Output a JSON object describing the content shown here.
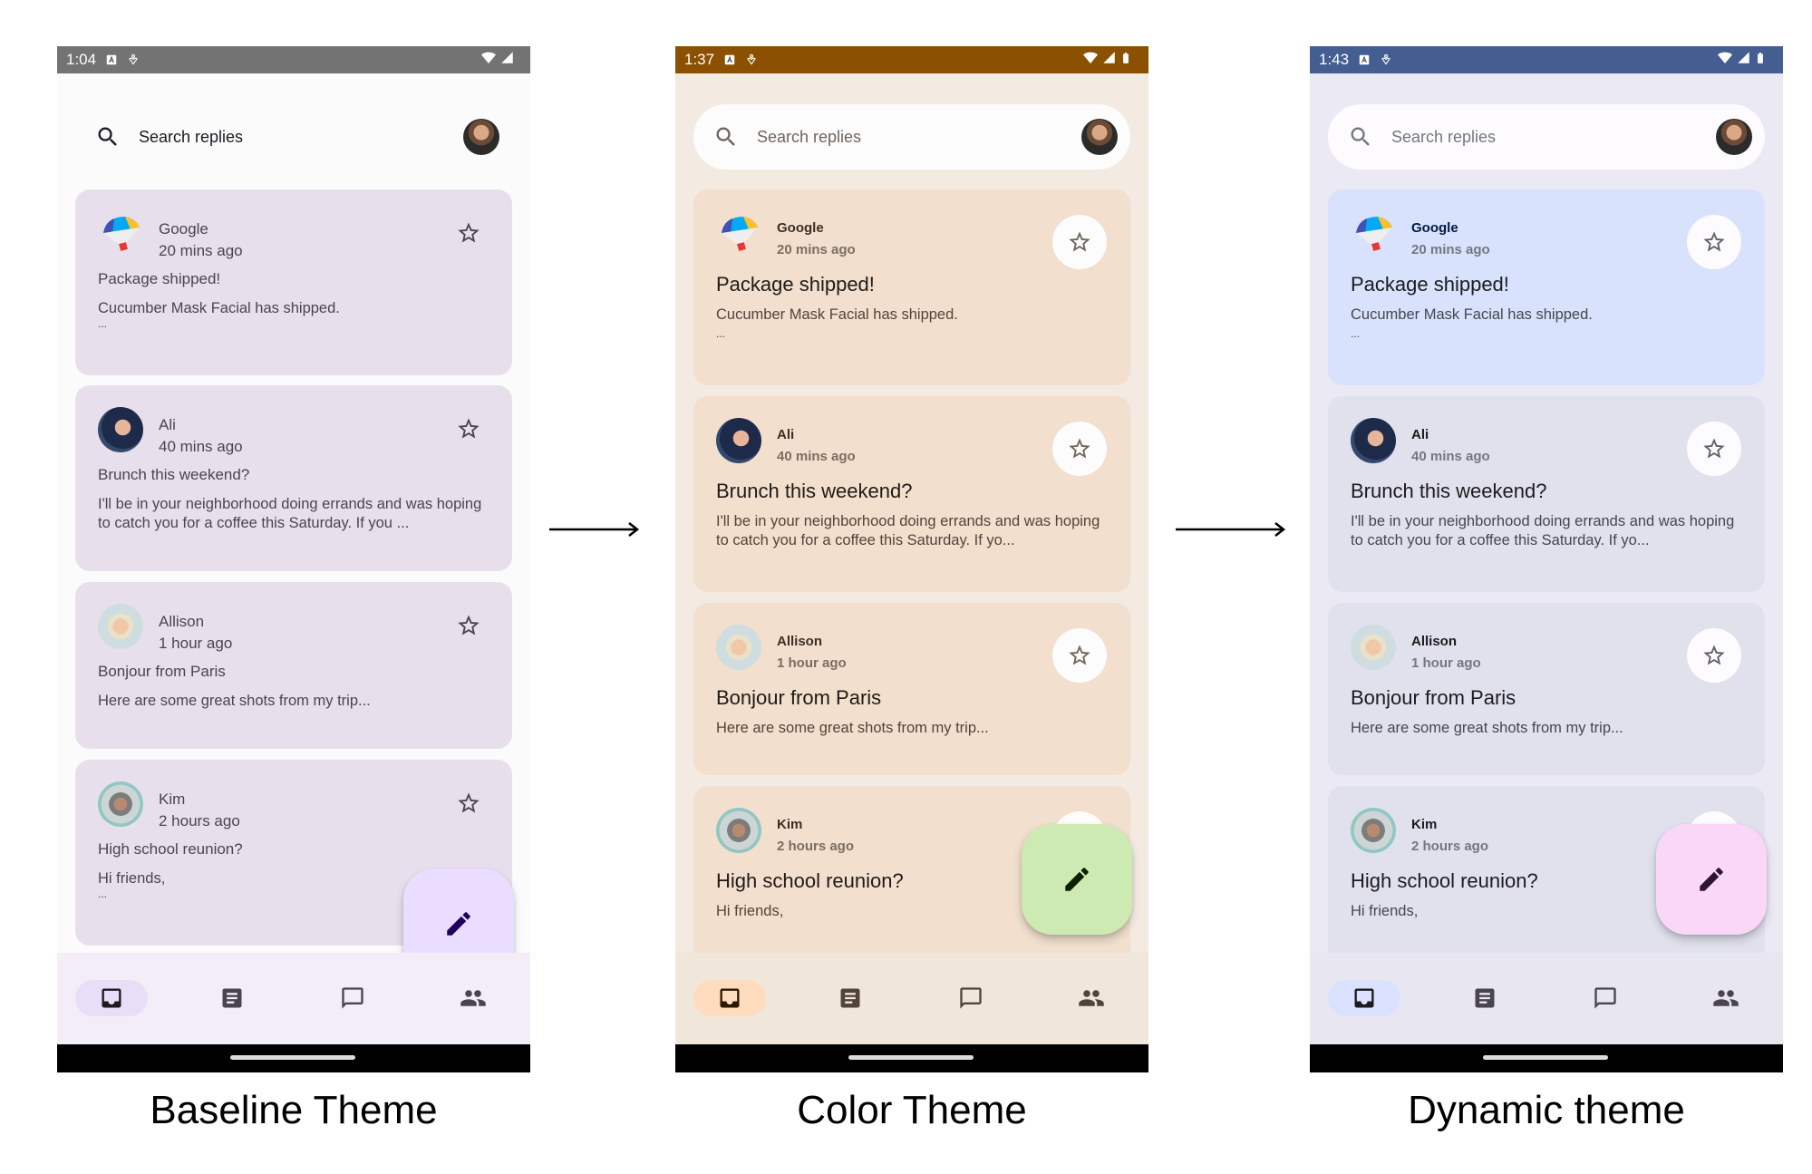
{
  "captions": [
    "Baseline Theme",
    "Color Theme",
    "Dynamic theme"
  ],
  "phones": [
    {
      "theme": "baseline",
      "status_time": "1:04",
      "status_icons": [
        "a-icon",
        "accessibility-icon",
        "wifi-icon",
        "signal-icon"
      ],
      "search_placeholder": "Search replies",
      "emails": [
        {
          "sender": "Google",
          "time": "20 mins ago",
          "subject": "Package shipped!",
          "body": "Cucumber Mask Facial has shipped.",
          "ellipsis": "..."
        },
        {
          "sender": "Ali",
          "time": "40 mins ago",
          "subject": "Brunch this weekend?",
          "body": "I'll be in your neighborhood doing errands and was hoping to catch you for a coffee this Saturday. If you ..."
        },
        {
          "sender": "Allison",
          "time": "1 hour ago",
          "subject": "Bonjour from Paris",
          "body": "Here are some great shots from my trip..."
        },
        {
          "sender": "Kim",
          "time": "2 hours ago",
          "subject": "High school reunion?",
          "body": "Hi friends,",
          "ellipsis": "..."
        }
      ],
      "nav": [
        "inbox",
        "articles",
        "direct-messages",
        "groups"
      ],
      "active_nav": "inbox",
      "colors": {
        "status_bar": "#737373",
        "card": "#e7e0ec",
        "fab": "#eaddff",
        "fab_icon": "#21005d"
      }
    },
    {
      "theme": "color",
      "status_time": "1:37",
      "status_icons": [
        "a-icon",
        "accessibility-icon",
        "wifi-icon",
        "signal-icon",
        "battery-icon"
      ],
      "search_placeholder": "Search replies",
      "emails": [
        {
          "sender": "Google",
          "time": "20 mins ago",
          "subject": "Package shipped!",
          "body": "Cucumber Mask Facial has shipped.",
          "ellipsis": "..."
        },
        {
          "sender": "Ali",
          "time": "40 mins ago",
          "subject": "Brunch this weekend?",
          "body": "I'll be in your neighborhood doing errands and was hoping to catch you for a coffee this Saturday. If yo..."
        },
        {
          "sender": "Allison",
          "time": "1 hour ago",
          "subject": "Bonjour from Paris",
          "body": "Here are some great shots from my trip..."
        },
        {
          "sender": "Kim",
          "time": "2 hours ago",
          "subject": "High school reunion?",
          "body": "Hi friends,"
        }
      ],
      "nav": [
        "inbox",
        "articles",
        "direct-messages",
        "groups"
      ],
      "active_nav": "inbox",
      "colors": {
        "status_bar": "#8b5000",
        "card": "#f2dfce",
        "fab": "#cdeab3",
        "fab_icon": "#0f2000"
      }
    },
    {
      "theme": "dynamic",
      "status_time": "1:43",
      "status_icons": [
        "a-icon",
        "accessibility-icon",
        "wifi-icon",
        "signal-icon",
        "battery-icon"
      ],
      "search_placeholder": "Search replies",
      "emails": [
        {
          "sender": "Google",
          "time": "20 mins ago",
          "subject": "Package shipped!",
          "body": "Cucumber Mask Facial has shipped.",
          "ellipsis": "..."
        },
        {
          "sender": "Ali",
          "time": "40 mins ago",
          "subject": "Brunch this weekend?",
          "body": "I'll be in your neighborhood doing errands and was hoping to catch you for a coffee this Saturday. If yo..."
        },
        {
          "sender": "Allison",
          "time": "1 hour ago",
          "subject": "Bonjour from Paris",
          "body": "Here are some great shots from my trip..."
        },
        {
          "sender": "Kim",
          "time": "2 hours ago",
          "subject": "High school reunion?",
          "body": "Hi friends,"
        }
      ],
      "nav": [
        "inbox",
        "articles",
        "direct-messages",
        "groups"
      ],
      "active_nav": "inbox",
      "colors": {
        "status_bar": "#445e91",
        "card": "#e0e1ec",
        "card_selected": "#d8e2fc",
        "fab": "#fad7f7",
        "fab_icon": "#2e1530"
      }
    }
  ]
}
